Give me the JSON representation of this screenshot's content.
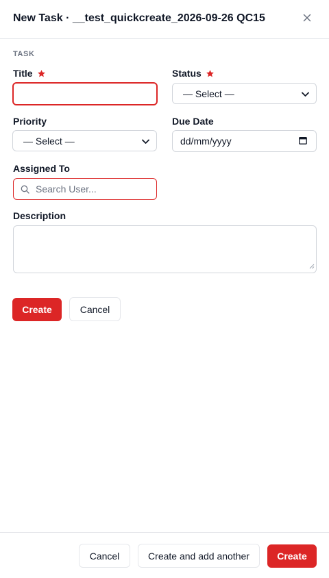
{
  "dialog": {
    "title": "New Task · __test_quickcreate_2026-09-26 QC15",
    "close_icon": "close-icon"
  },
  "form": {
    "section_label": "TASK",
    "title": {
      "label": "Title",
      "value": "",
      "required": true
    },
    "status": {
      "label": "Status",
      "selected": "— Select —",
      "required": true
    },
    "priority": {
      "label": "Priority",
      "selected": "— Select —"
    },
    "due_date": {
      "label": "Due Date",
      "placeholder": "dd/mm/yyyy",
      "icon": "calendar-icon"
    },
    "assigned_to": {
      "label": "Assigned To",
      "placeholder": "Search User...",
      "icon": "search-icon"
    },
    "description": {
      "label": "Description",
      "value": ""
    },
    "create_label": "Create",
    "cancel_label": "Cancel"
  },
  "footer": {
    "cancel_label": "Cancel",
    "create_another_label": "Create and add another",
    "create_label": "Create"
  },
  "colors": {
    "accent": "#dc2626",
    "border": "#d1d5db",
    "muted_text": "#6b7280"
  }
}
